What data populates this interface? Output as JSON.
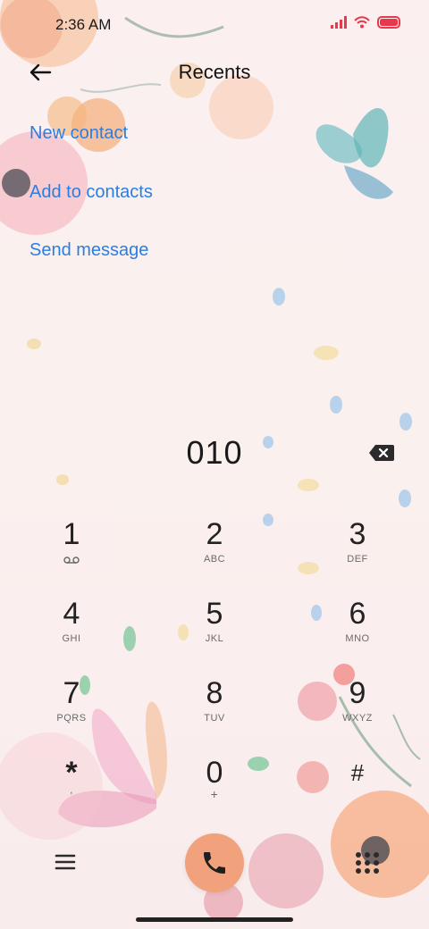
{
  "status_bar": {
    "time": "2:36 AM"
  },
  "header": {
    "title": "Recents"
  },
  "actions": [
    {
      "label": "New contact"
    },
    {
      "label": "Add to contacts"
    },
    {
      "label": "Send message"
    }
  ],
  "dial": {
    "entered_number": "010"
  },
  "keypad": {
    "keys": [
      {
        "digit": "1",
        "letters": ""
      },
      {
        "digit": "2",
        "letters": "ABC"
      },
      {
        "digit": "3",
        "letters": "DEF"
      },
      {
        "digit": "4",
        "letters": "GHI"
      },
      {
        "digit": "5",
        "letters": "JKL"
      },
      {
        "digit": "6",
        "letters": "MNO"
      },
      {
        "digit": "7",
        "letters": "PQRS"
      },
      {
        "digit": "8",
        "letters": "TUV"
      },
      {
        "digit": "9",
        "letters": "WXYZ"
      },
      {
        "digit": "*",
        "letters": ","
      },
      {
        "digit": "0",
        "letters": "+"
      },
      {
        "digit": "#",
        "letters": ""
      }
    ]
  },
  "colors": {
    "accent_link": "#2a7ee3",
    "call_button": "#f1a27c",
    "battery": "#e8384b"
  }
}
